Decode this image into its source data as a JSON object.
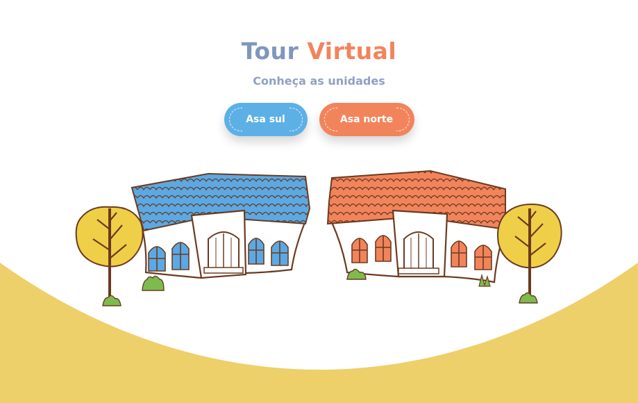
{
  "header": {
    "title_part1": "Tour",
    "title_part2": "Virtual",
    "subtitle": "Conheça as unidades"
  },
  "buttons": {
    "sul_label": "Asa sul",
    "norte_label": "Asa norte"
  },
  "colors": {
    "blue": "#5db0e6",
    "orange": "#f2845c",
    "title_gray_blue": "#7f97bc",
    "ground_yellow": "#edd06a",
    "tree_yellow": "#f0cf48"
  },
  "illustration": {
    "left": "house-blue-roof",
    "right": "house-orange-roof"
  }
}
